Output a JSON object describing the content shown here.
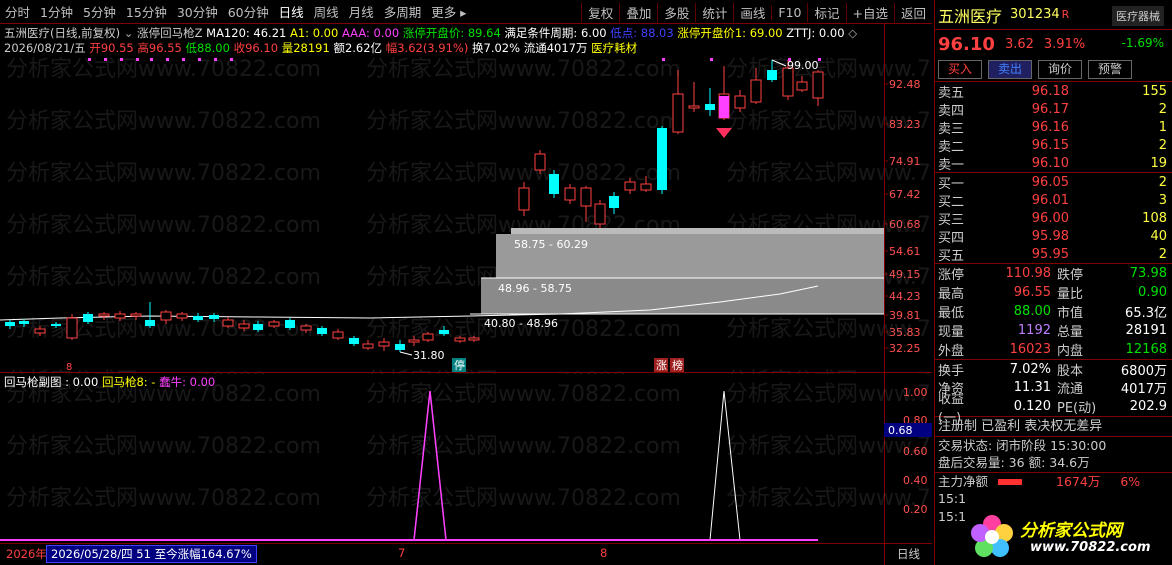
{
  "toolbar": {
    "periods": [
      "分时",
      "1分钟",
      "5分钟",
      "15分钟",
      "30分钟",
      "60分钟",
      "日线",
      "周线",
      "月线",
      "多周期",
      "更多"
    ],
    "active_period": "日线",
    "right_items": [
      "复权",
      "叠加",
      "多股",
      "统计",
      "画线",
      "F10",
      "标记",
      "+自选",
      "返回"
    ]
  },
  "chart_info": {
    "title": "五洲医疗(日线,前复权)",
    "formula_name": "涨停回马枪Z",
    "ma120": "MA120: 46.21",
    "a1": "A1: 0.00",
    "aaa": "AAA: 0.00",
    "limit_open": "涨停开盘价: 89.64",
    "cycle": "满足条件周期: 6.00",
    "low_pt": "低点: 88.03",
    "limit_open1": "涨停开盘价1: 69.00",
    "zttj": "ZTTJ: 0.00"
  },
  "bar_info": {
    "date": "2026/08/21/五",
    "open": "开90.55",
    "high": "高96.55",
    "low": "低88.00",
    "close": "收96.10",
    "vol": "量28191",
    "amount": "额2.62亿",
    "range": "幅3.62(3.91%)",
    "turnover": "换7.02%",
    "float": "流通4017万",
    "sector": "医疗耗材"
  },
  "price_axis": [
    "92.48",
    "83.23",
    "74.91",
    "67.42",
    "60.68",
    "54.61",
    "49.15",
    "44.23",
    "39.81",
    "35.83",
    "32.25"
  ],
  "zones": [
    {
      "label": "58.75 - 60.29"
    },
    {
      "label": "48.96 - 58.75"
    },
    {
      "label": "40.80 - 48.96"
    }
  ],
  "annotations": {
    "high_label": "99.00",
    "low_label": "31.80",
    "stop_tag": "停",
    "limit_tag": "涨",
    "rank_tag": "榜",
    "marker_left": "8"
  },
  "sub_chart": {
    "title": "回马枪副图 : 0.00",
    "label2": "回马枪8: -",
    "label3": "蠢牛: 0.00",
    "axis": [
      "1.00",
      "0.80",
      "0.60",
      "0.40",
      "0.20"
    ],
    "cursor_value": "0.68"
  },
  "bottom": {
    "year": "2026年",
    "date_info": "2026/05/28/四 51 至今涨幅164.67%",
    "marker7": "7",
    "marker8": "8",
    "period_btn": "日线"
  },
  "panel": {
    "name": "五洲医疗",
    "code": "301234",
    "r_flag": "R",
    "sector_badge": "医疗器械",
    "price": "96.10",
    "change": "3.62",
    "change_pct": "3.91%",
    "sector_pct": "-1.69%",
    "buttons": [
      "买入",
      "卖出",
      "询价",
      "预警"
    ],
    "asks": [
      {
        "label": "卖五",
        "price": "96.18",
        "vol": "155"
      },
      {
        "label": "卖四",
        "price": "96.17",
        "vol": "2"
      },
      {
        "label": "卖三",
        "price": "96.16",
        "vol": "1"
      },
      {
        "label": "卖二",
        "price": "96.15",
        "vol": "2"
      },
      {
        "label": "卖一",
        "price": "96.10",
        "vol": "19"
      }
    ],
    "bids": [
      {
        "label": "买一",
        "price": "96.05",
        "vol": "2"
      },
      {
        "label": "买二",
        "price": "96.01",
        "vol": "3"
      },
      {
        "label": "买三",
        "price": "96.00",
        "vol": "108"
      },
      {
        "label": "买四",
        "price": "95.98",
        "vol": "40"
      },
      {
        "label": "买五",
        "price": "95.95",
        "vol": "2"
      }
    ],
    "quotes": [
      {
        "k": "涨停",
        "v": "110.98",
        "vc": "red",
        "k2": "跌停",
        "v2": "73.98",
        "v2c": "green"
      },
      {
        "k": "最高",
        "v": "96.55",
        "vc": "red",
        "k2": "量比",
        "v2": "0.90",
        "v2c": "green"
      },
      {
        "k": "最低",
        "v": "88.00",
        "vc": "green",
        "k2": "市值",
        "v2": "65.3亿",
        "v2c": "white"
      },
      {
        "k": "现量",
        "v": "1192",
        "vc": "purple",
        "k2": "总量",
        "v2": "28191",
        "v2c": "white"
      },
      {
        "k": "外盘",
        "v": "16023",
        "vc": "red",
        "k2": "内盘",
        "v2": "12168",
        "v2c": "green"
      },
      {
        "k": "换手",
        "v": "7.02%",
        "vc": "white",
        "k2": "股本",
        "v2": "6800万",
        "v2c": "white"
      },
      {
        "k": "净资",
        "v": "11.31",
        "vc": "white",
        "k2": "流通",
        "v2": "4017万",
        "v2c": "white"
      },
      {
        "k": "收益(一)",
        "v": "0.120",
        "vc": "white",
        "k2": "PE(动)",
        "v2": "202.9",
        "v2c": "white"
      }
    ],
    "reg_info": "注册制 已盈利 表决权无差异",
    "trade_status": "交易状态: 闭市阶段 15:30:00",
    "after_trade": "盘后交易量: 36  额: 34.6万",
    "main_flow_label": "主力净额",
    "main_flow_value": "1674万",
    "main_flow_pct": "6%",
    "time1": "15:1",
    "time2": "15:1",
    "logo_text": "分析家公式网",
    "logo_url": "www.70822.com"
  },
  "colors": {
    "up": "#ff4040",
    "down": "#00ffff",
    "grid": "#800000"
  }
}
